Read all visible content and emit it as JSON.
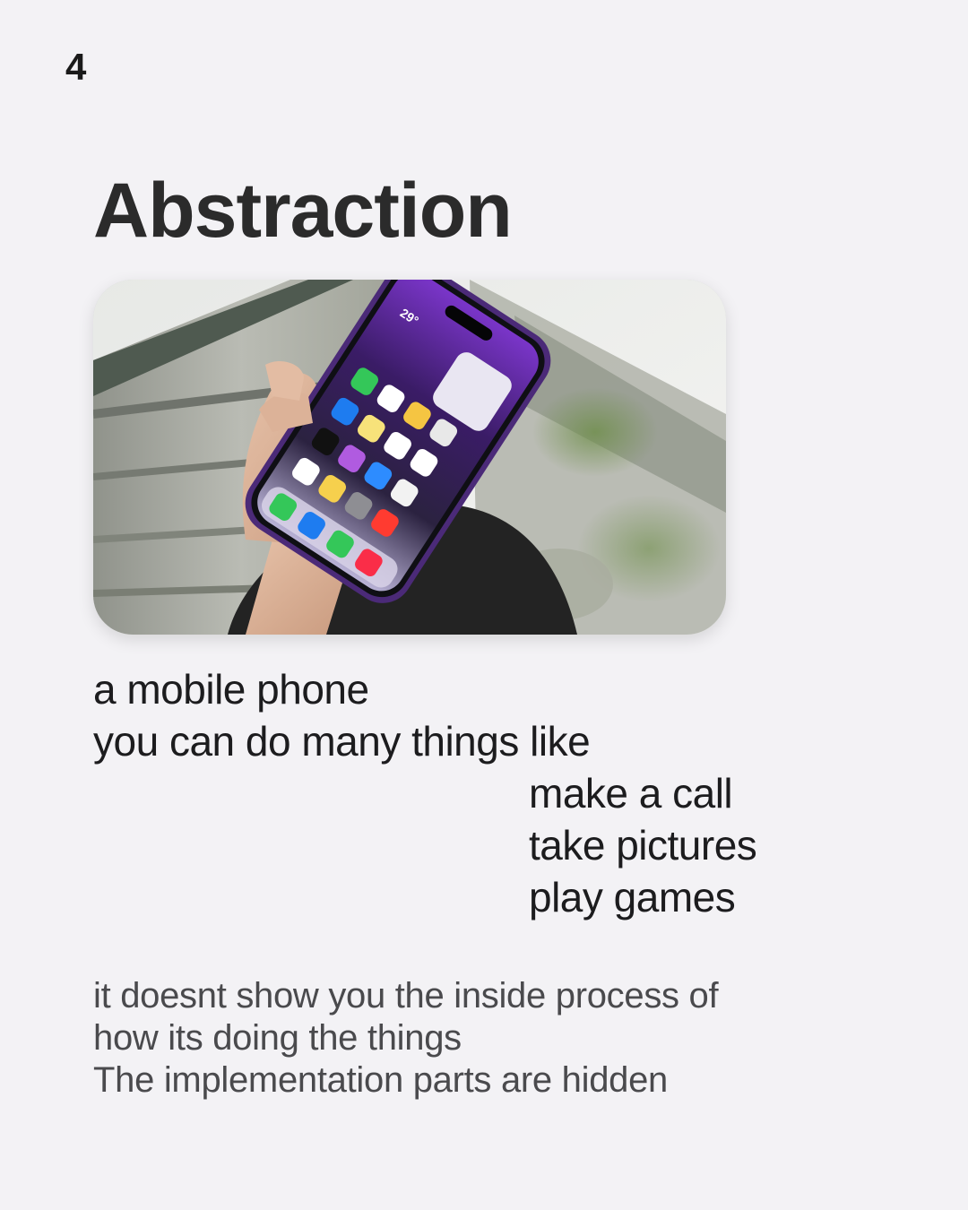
{
  "slide": {
    "number": "4",
    "title": "Abstraction"
  },
  "photo": {
    "subject": "hand holding a smartphone with purple home screen",
    "phone_widget_temperature": "29°"
  },
  "intro_lines": [
    "a mobile phone",
    "you can do many things like"
  ],
  "abilities": [
    "make a call",
    "take pictures",
    "play games"
  ],
  "explanation_lines": [
    "it doesnt show you the inside process of",
    "how its doing the things",
    "The implementation parts are hidden"
  ],
  "colors": {
    "background": "#f3f2f5",
    "title": "#2b2b2b",
    "body_text": "#1c1c1e",
    "muted_text": "#4a4a4d",
    "phone_accent": "#7b3fd6"
  }
}
